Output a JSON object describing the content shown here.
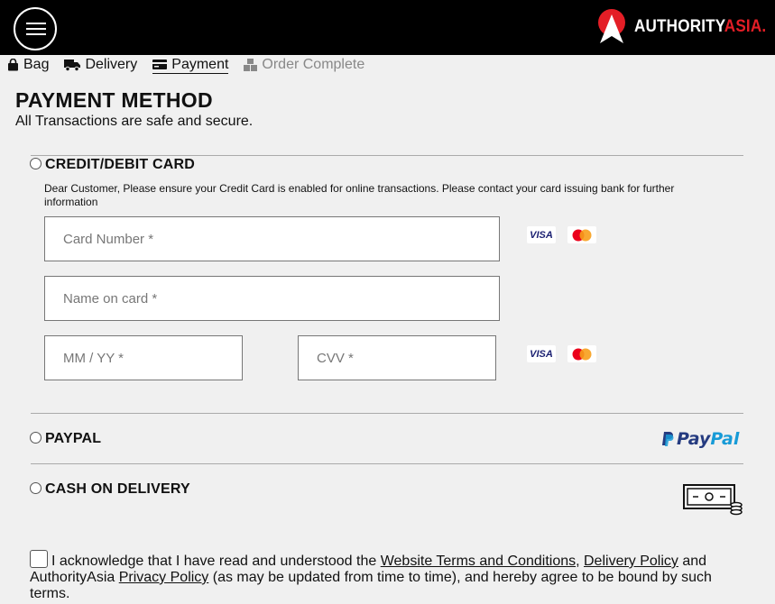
{
  "header": {
    "menu_icon": "hamburger-menu-icon",
    "logo": {
      "part1": "AUTHORITY",
      "part2": "ASIA.",
      "brand_color": "#e41e26"
    }
  },
  "steps": [
    {
      "label": "Bag",
      "icon": "bag-icon",
      "state": "done"
    },
    {
      "label": "Delivery",
      "icon": "truck-icon",
      "state": "done"
    },
    {
      "label": "Payment",
      "icon": "credit-card-icon",
      "state": "active"
    },
    {
      "label": "Order Complete",
      "icon": "boxes-icon",
      "state": "upcoming"
    }
  ],
  "page": {
    "title": "PAYMENT METHOD",
    "subtitle": "All Transactions are safe and secure."
  },
  "credit_card": {
    "label": "CREDIT/DEBIT CARD",
    "notice": "Dear Customer, Please ensure your Credit Card is enabled for online transactions. Please contact your card issuing bank for further information",
    "card_number_placeholder": "Card Number *",
    "name_placeholder": "Name on card *",
    "expiry_placeholder": "MM / YY *",
    "cvv_placeholder": "CVV *",
    "visa_label": "VISA"
  },
  "paypal": {
    "label": "PAYPAL",
    "logo_pay": "Pay",
    "logo_pal": "Pal"
  },
  "cod": {
    "label": "CASH ON DELIVERY",
    "icon": "cash-icon"
  },
  "terms": {
    "prefix": "I acknowledge that I have read and understood the ",
    "link1": "Website Terms and Conditions",
    "sep1": ", ",
    "link2": "Delivery Policy",
    "mid": " and AuthorityAsia ",
    "link3": "Privacy Policy",
    "suffix": " (as may be updated from time to time), and hereby agree to be bound by such terms."
  }
}
